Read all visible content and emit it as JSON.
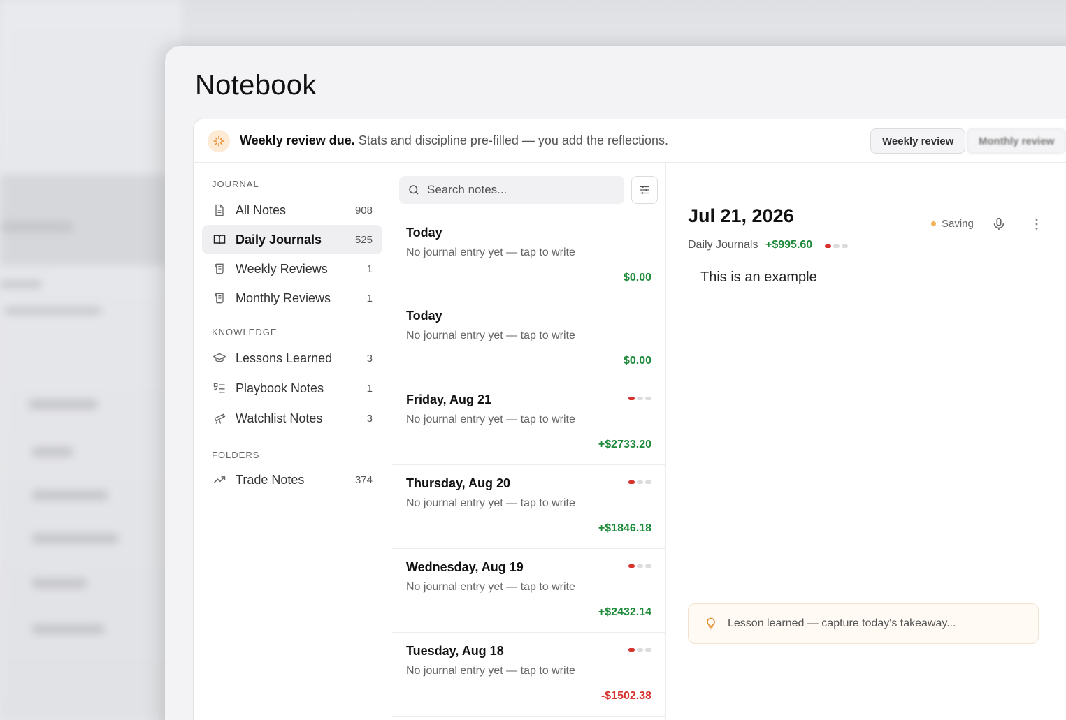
{
  "app": {
    "title": "Notebook"
  },
  "banner": {
    "strong": "Weekly review due.",
    "text": " Stats and discipline pre-filled — you add the reflections.",
    "weekly_button": "Weekly review",
    "monthly_button": "Monthly review",
    "icon": "sparkle-icon"
  },
  "sidebar": {
    "journal_label": "JOURNAL",
    "knowledge_label": "KNOWLEDGE",
    "folders_label": "FOLDERS",
    "journal_items": [
      {
        "label": "All Notes",
        "count": "908",
        "icon": "document-icon"
      },
      {
        "label": "Daily Journals",
        "count": "525",
        "icon": "book-icon"
      },
      {
        "label": "Weekly Reviews",
        "count": "1",
        "icon": "scroll-icon"
      },
      {
        "label": "Monthly Reviews",
        "count": "1",
        "icon": "scroll-icon"
      }
    ],
    "knowledge_items": [
      {
        "label": "Lessons Learned",
        "count": "3",
        "icon": "graduation-cap-icon"
      },
      {
        "label": "Playbook Notes",
        "count": "1",
        "icon": "checklist-icon"
      },
      {
        "label": "Watchlist Notes",
        "count": "3",
        "icon": "telescope-icon"
      }
    ],
    "folder_items": [
      {
        "label": "Trade Notes",
        "count": "374",
        "icon": "trending-up-icon"
      }
    ]
  },
  "list": {
    "search_placeholder": "Search notes...",
    "entries": [
      {
        "title": "Today",
        "subtitle": "No journal entry yet — tap to write",
        "amount": "$0.00"
      },
      {
        "title": "Today",
        "subtitle": "No journal entry yet — tap to write",
        "amount": "$0.00"
      },
      {
        "title": "Friday, Aug 21",
        "subtitle": "No journal entry yet — tap to write",
        "amount": "+$2733.20"
      },
      {
        "title": "Thursday, Aug 20",
        "subtitle": "No journal entry yet — tap to write",
        "amount": "+$1846.18"
      },
      {
        "title": "Wednesday, Aug 19",
        "subtitle": "No journal entry yet — tap to write",
        "amount": "+$2432.14"
      },
      {
        "title": "Tuesday, Aug 18",
        "subtitle": "No journal entry yet — tap to write",
        "amount": "-$1502.38"
      }
    ]
  },
  "editor": {
    "date": "Jul 21, 2026",
    "folder": "Daily Journals",
    "amount": "+$995.60",
    "status": "Saving",
    "body": "This is an example",
    "lesson_placeholder": "Lesson learned — capture today's takeaway..."
  },
  "colors": {
    "positive": "#1e8a3a",
    "negative": "#d6322e",
    "accent": "#e98a2c"
  }
}
